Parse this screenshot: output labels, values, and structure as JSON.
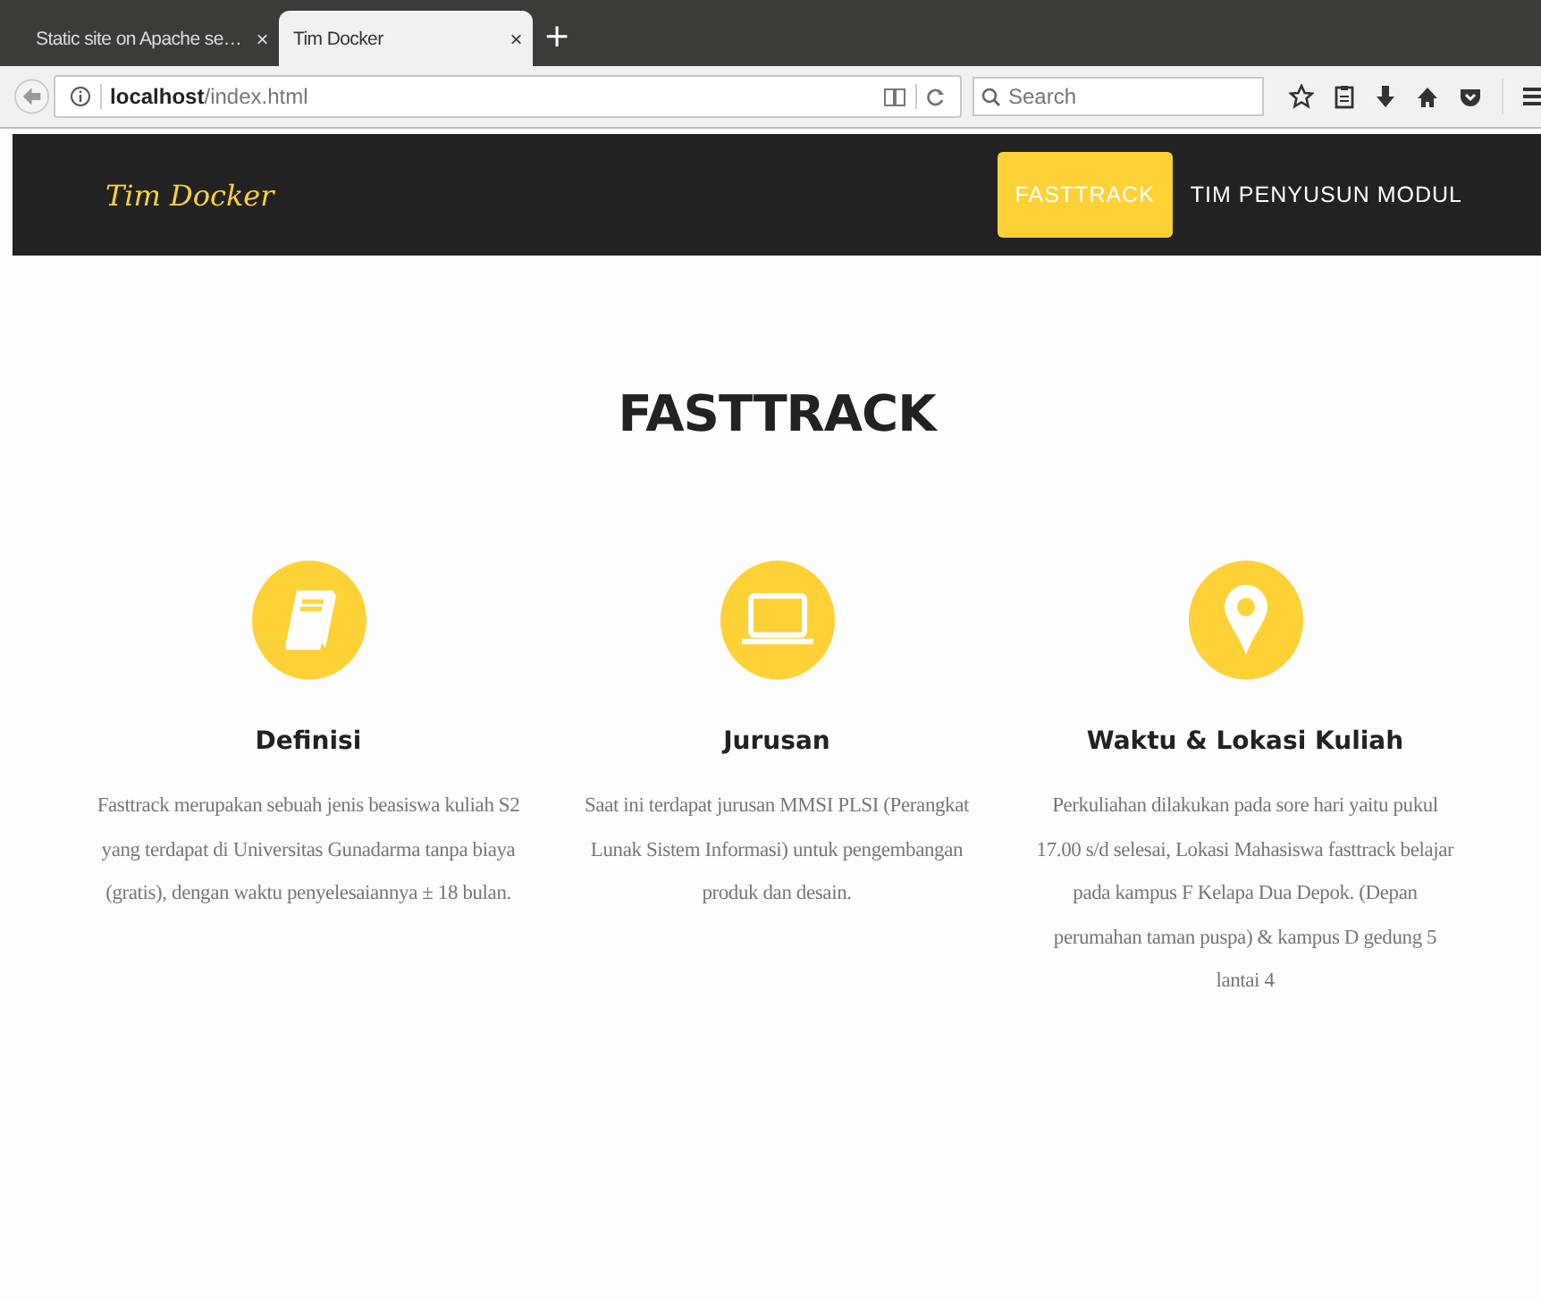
{
  "browser": {
    "tabs": [
      {
        "title": "Static site on Apache se…",
        "selected": false,
        "close": "×"
      },
      {
        "title": "Tim Docker",
        "selected": true,
        "close": "×"
      }
    ],
    "new_tab": "+",
    "url": {
      "host": "localhost",
      "path": "/index.html"
    },
    "search": {
      "placeholder": "Search"
    }
  },
  "navbar": {
    "brand": "Tim Docker",
    "items": [
      {
        "label": "FASTTRACK",
        "selected": true
      },
      {
        "label": "TIM PENYUSUN MODUL",
        "selected": false
      }
    ]
  },
  "heading": "FASTTRACK",
  "features": [
    {
      "kind": "book",
      "title": "Definisi",
      "text": "Fasttrack merupakan sebuah jenis beasiswa kuliah S2 yang terdapat di Universitas Gunadarma tanpa biaya (gratis), dengan waktu penyelesaiannya ± 18 bulan."
    },
    {
      "kind": "laptop",
      "title": "Jurusan",
      "text": "Saat ini terdapat jurusan MMSI PLSI (Perangkat Lunak Sistem Informasi) untuk pengembangan produk dan desain."
    },
    {
      "kind": "pin",
      "title": "Waktu & Lokasi Kuliah",
      "text": "Perkuliahan dilakukan pada sore hari yaitu pukul 17.00 s/d selesai, Lokasi Mahasiswa fasttrack belajar pada kampus F Kelapa Dua Depok. (Depan perumahan taman puspa) & kampus D gedung 5 lantai 4"
    }
  ]
}
